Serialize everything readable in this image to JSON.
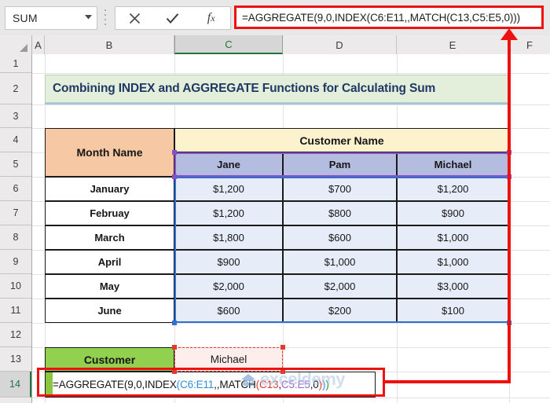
{
  "formula_bar": {
    "name_box_value": "SUM",
    "name_box_caret": "▼",
    "cancel_icon": "cancel-x-icon",
    "confirm_icon": "confirm-check-icon",
    "insert_function_icon": "fx-icon",
    "formula_text": "=AGGREGATE(9,0,INDEX(C6:E11,,MATCH(C13,C5:E5,0)))"
  },
  "columns": [
    "A",
    "B",
    "C",
    "D",
    "E",
    "F"
  ],
  "selected_column": "C",
  "rows": [
    "1",
    "2",
    "3",
    "4",
    "5",
    "6",
    "7",
    "8",
    "9",
    "10",
    "11",
    "12",
    "13",
    "14"
  ],
  "selected_row": "14",
  "title_banner": {
    "text": "Combining INDEX and AGGREGATE Functions for Calculating Sum"
  },
  "table": {
    "month_header": "Month Name",
    "customer_band_header": "Customer Name",
    "customer_names": [
      "Jane",
      "Pam",
      "Michael"
    ],
    "rows": [
      {
        "month": "January",
        "values": [
          "$1,200",
          "$700",
          "$1,200"
        ]
      },
      {
        "month": "Februay",
        "values": [
          "$1,200",
          "$800",
          "$900"
        ]
      },
      {
        "month": "March",
        "values": [
          "$1,800",
          "$600",
          "$1,000"
        ]
      },
      {
        "month": "April",
        "values": [
          "$900",
          "$1,000",
          "$1,000"
        ]
      },
      {
        "month": "May",
        "values": [
          "$2,000",
          "$2,000",
          "$3,000"
        ]
      },
      {
        "month": "June",
        "values": [
          "$600",
          "$200",
          "$100"
        ]
      }
    ]
  },
  "lookup": {
    "label": "Customer",
    "value": "Michael"
  },
  "formula_cell": {
    "tokens": [
      {
        "text": "=AGGREGATE(9,0,INDEX",
        "color": "black"
      },
      {
        "text": "(",
        "color": "blue"
      },
      {
        "text": "C6:E11",
        "color": "blue"
      },
      {
        "text": ",,MATCH",
        "color": "black"
      },
      {
        "text": "(",
        "color": "red"
      },
      {
        "text": "C13",
        "color": "red"
      },
      {
        "text": ",",
        "color": "black"
      },
      {
        "text": "C5:E5",
        "color": "purple"
      },
      {
        "text": ",0",
        "color": "black"
      },
      {
        "text": ")",
        "color": "red"
      },
      {
        "text": ")",
        "color": "blue"
      },
      {
        "text": ")",
        "color": "green"
      }
    ],
    "plain": "=AGGREGATE(9,0,INDEX(C6:E11,,MATCH(C13,C5:E5,0)))"
  },
  "watermark": {
    "text": "exceldemy"
  },
  "colors": {
    "annotation_red": "#ef1010",
    "title_banner_fill": "#e3efdb",
    "title_text": "#1f3864",
    "month_header_fill": "#f6c9a4",
    "customer_band_fill": "#fdf2ce",
    "name_row_fill": "#b4bce0",
    "value_fill": "#e7edf8",
    "customer_label_fill": "#92d050",
    "lookup_value_fill": "#fdeeec",
    "range_blue": "#2f6fd0",
    "range_purple": "#8a4fc4",
    "range_red": "#e23a2e",
    "excel_green": "#217346"
  }
}
